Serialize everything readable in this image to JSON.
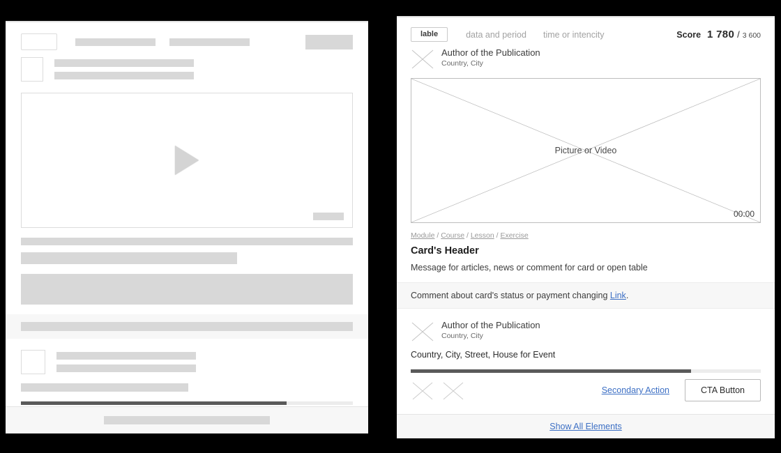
{
  "colors": {
    "frame": "#000000",
    "card_bg": "#ffffff",
    "skeleton": "#d8d8d8",
    "strip_bg": "#f7f7f7",
    "link_blue": "#3c6fc4",
    "progress_fill": "#5a5a5a",
    "progress_track": "#ececec",
    "outline": "#dcdcdc",
    "muted_text": "#a2a2a2"
  },
  "left_panel": {
    "name": "skeleton-placeholder-card",
    "progress_percent": 80,
    "header": {
      "chip": "",
      "meta_1": "",
      "meta_2": "",
      "right_block": ""
    },
    "media": {
      "type": "video",
      "play_icon": "play-icon",
      "timestamp_placeholder": ""
    },
    "footer_bar": ""
  },
  "right_panel": {
    "header": {
      "chip_label": "lable",
      "meta_1": "data and period",
      "meta_2": "time or intencity",
      "score_label": "Score",
      "score_value": "1 780",
      "score_separator": "/",
      "score_max": "3 600"
    },
    "author_top": {
      "avatar_icon": "avatar-cross-icon",
      "name": "Author of the Publication",
      "location": "Country, City"
    },
    "media": {
      "placeholder_text": "Picture or Video",
      "timestamp": "00:00"
    },
    "breadcrumb": {
      "items": [
        "Module",
        "Course",
        "Lesson",
        "Exercise"
      ],
      "separator": "/"
    },
    "card_header": "Card's Header",
    "message": "Message for articles, news or comment for card or open table",
    "note": {
      "text_before": "Comment about card's status or payment changing ",
      "link_label": "Link",
      "text_after": "."
    },
    "author_bottom": {
      "avatar_icon": "avatar-cross-icon",
      "name": "Author of the Publication",
      "location": "Country, City"
    },
    "address": "Country, City, Street, House for Event",
    "progress_percent": 80,
    "actions": {
      "icon_1": "close-cross-icon",
      "icon_2": "close-cross-icon",
      "secondary_label": "Secondary Action",
      "cta_label": "CTA Button"
    },
    "footer_link": "Show All Elements"
  }
}
